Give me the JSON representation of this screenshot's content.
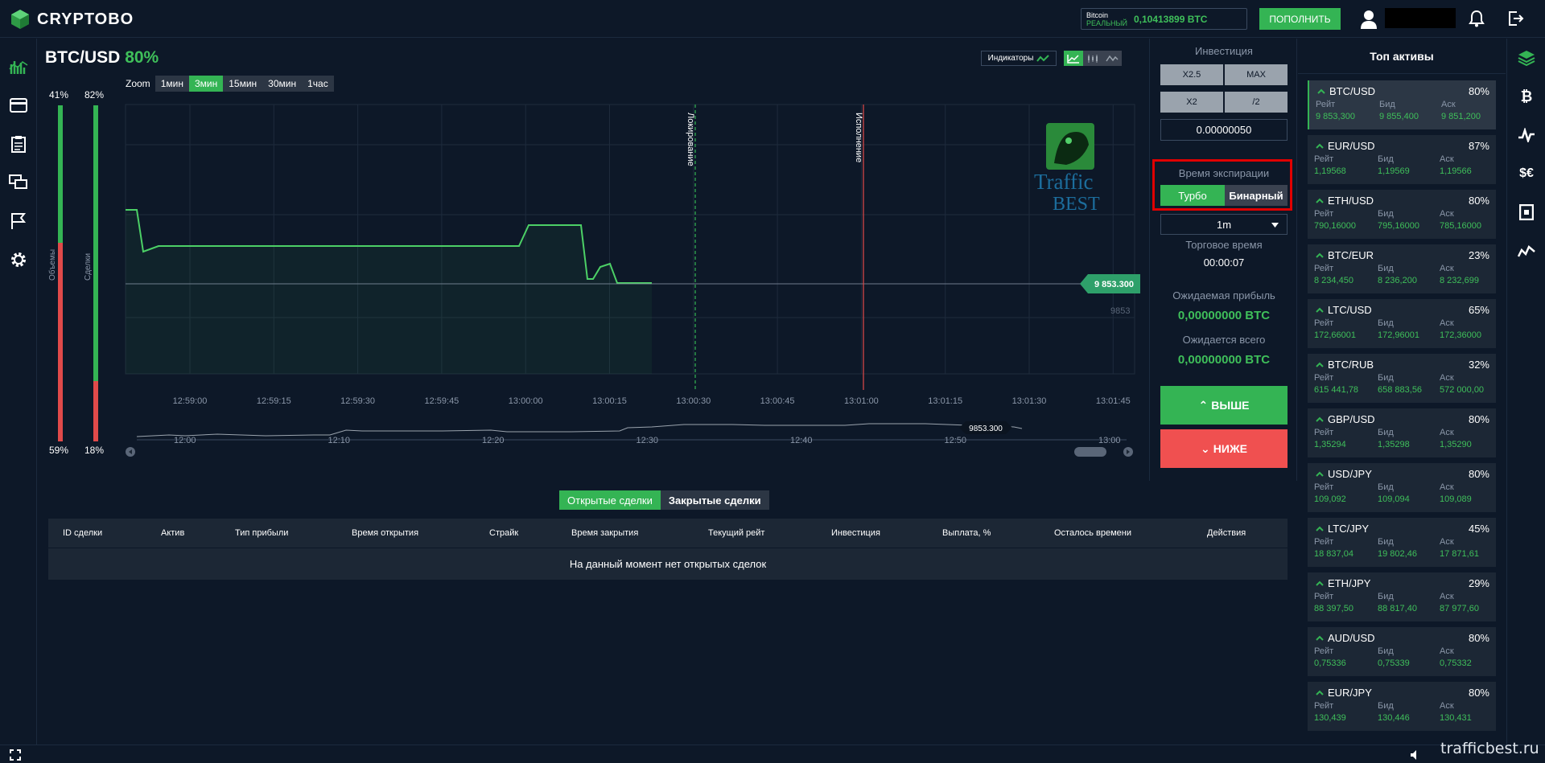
{
  "header": {
    "brand": "CRYPTOBO",
    "balance_coin": "Bitcoin",
    "balance_mode": "РЕАЛЬНЫЙ",
    "balance_value": "0,10413899 BTC",
    "deposit_label": "ПОПОЛНИТЬ"
  },
  "chart_header": {
    "pair": "BTC/USD",
    "payout": "80%",
    "indicators_label": "Индикаторы",
    "zoom_label": "Zoom",
    "zoom_options": [
      "1мин",
      "3мин",
      "15мин",
      "30мин",
      "1час"
    ],
    "zoom_active": "3мин"
  },
  "volumes": {
    "left_top": "41%",
    "left_bottom": "59%",
    "left_green_fraction": 0.41,
    "left_label": "Объемы",
    "right_top": "82%",
    "right_bottom": "18%",
    "right_green_fraction": 0.82,
    "right_label": "Сделки"
  },
  "chart_data": {
    "type": "line",
    "x_ticks": [
      "12:59:00",
      "12:59:15",
      "12:59:30",
      "12:59:45",
      "13:00:00",
      "13:00:15",
      "13:00:30",
      "13:00:45",
      "13:01:00",
      "13:01:15",
      "13:01:30",
      "13:01:45"
    ],
    "lock_label": "Локирование",
    "expiry_label": "Исполнение",
    "current_price_tag": "9 853.300",
    "price_axis_label": "9853",
    "navigator_ticks": [
      "12:00",
      "12:10",
      "12:20",
      "12:30",
      "12:40",
      "12:50",
      "13:00"
    ],
    "navigator_price": "9853.300",
    "watermark_line1": "Traffic",
    "watermark_line2": "BEST"
  },
  "trade_panel": {
    "investment_label": "Инвестиция",
    "btn_x25": "X2.5",
    "btn_max": "MAX",
    "btn_x2": "X2",
    "btn_half": "/2",
    "investment_value": "0.00000050",
    "expiry_label": "Время экспирации",
    "expiry_turbo": "Турбо",
    "expiry_binary": "Бинарный",
    "expiry_select": "1m",
    "trade_time_label": "Торговое время",
    "trade_time_value": "00:00:07",
    "expected_profit_label": "Ожидаемая прибыль",
    "expected_profit_value": "0,00000000 BTC",
    "expected_total_label": "Ожидается всего",
    "expected_total_value": "0,00000000 BTC",
    "up_label": "ВЫШЕ",
    "down_label": "НИЖЕ"
  },
  "top_assets": {
    "title": "Топ активы",
    "col_rate": "Рейт",
    "col_bid": "Бид",
    "col_ask": "Аск",
    "items": [
      {
        "name": "BTC/USD",
        "pct": "80%",
        "rate": "9 853,300",
        "bid": "9 855,400",
        "ask": "9 851,200"
      },
      {
        "name": "EUR/USD",
        "pct": "87%",
        "rate": "1,19568",
        "bid": "1,19569",
        "ask": "1,19566"
      },
      {
        "name": "ETH/USD",
        "pct": "80%",
        "rate": "790,16000",
        "bid": "795,16000",
        "ask": "785,16000"
      },
      {
        "name": "BTC/EUR",
        "pct": "23%",
        "rate": "8 234,450",
        "bid": "8 236,200",
        "ask": "8 232,699"
      },
      {
        "name": "LTC/USD",
        "pct": "65%",
        "rate": "172,66001",
        "bid": "172,96001",
        "ask": "172,36000"
      },
      {
        "name": "BTC/RUB",
        "pct": "32%",
        "rate": "615 441,78",
        "bid": "658 883,56",
        "ask": "572 000,00"
      },
      {
        "name": "GBP/USD",
        "pct": "80%",
        "rate": "1,35294",
        "bid": "1,35298",
        "ask": "1,35290"
      },
      {
        "name": "USD/JPY",
        "pct": "80%",
        "rate": "109,092",
        "bid": "109,094",
        "ask": "109,089"
      },
      {
        "name": "LTC/JPY",
        "pct": "45%",
        "rate": "18 837,04",
        "bid": "19 802,46",
        "ask": "17 871,61"
      },
      {
        "name": "ETH/JPY",
        "pct": "29%",
        "rate": "88 397,50",
        "bid": "88 817,40",
        "ask": "87 977,60"
      },
      {
        "name": "AUD/USD",
        "pct": "80%",
        "rate": "0,75336",
        "bid": "0,75339",
        "ask": "0,75332"
      },
      {
        "name": "EUR/JPY",
        "pct": "80%",
        "rate": "130,439",
        "bid": "130,446",
        "ask": "130,431"
      }
    ]
  },
  "deals": {
    "tab_open": "Открытые сделки",
    "tab_closed": "Закрытые сделки",
    "columns": [
      "ID сделки",
      "Актив",
      "Тип прибыли",
      "Время открытия",
      "Страйк",
      "Время закрытия",
      "Текущий рейт",
      "Инвестиция",
      "Выплата, %",
      "Осталось времени",
      "Действия"
    ],
    "empty_message": "На данный момент нет открытых сделок"
  },
  "right_icons": [
    "layers-icon",
    "bitcoin-icon",
    "pulse-icon",
    "dollar-euro-icon",
    "box-icon",
    "trend-icon"
  ],
  "watermark": "trafficbest.ru",
  "colors": {
    "green": "#34b454",
    "red": "#f05050",
    "bg": "#0d1828"
  }
}
